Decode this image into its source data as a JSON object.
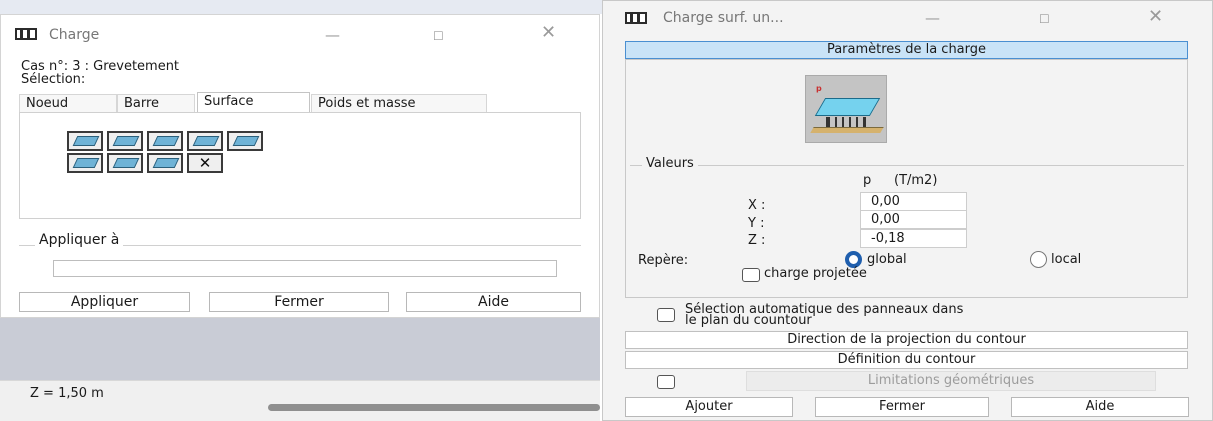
{
  "charge_window": {
    "title": "Charge",
    "case_line": "Cas n°: 3 : Grevetement",
    "selection_label": "Sélection:",
    "tabs": [
      {
        "label": "Noeud"
      },
      {
        "label": "Barre"
      },
      {
        "label": "Surface"
      },
      {
        "label": "Poids et masse"
      }
    ],
    "tools": [
      "surface-load-icon",
      "surface-load-icon",
      "surface-load-icon",
      "surface-load-icon",
      "surface-load-icon",
      "surface-load-icon",
      "surface-load-icon",
      "surface-load-icon",
      "delete-load-icon"
    ],
    "apply_group_label": "Appliquer à",
    "apply_input_value": "",
    "buttons": {
      "apply": "Appliquer",
      "close": "Fermer",
      "help": "Aide"
    }
  },
  "status": {
    "z_label": "Z = 1,50 m"
  },
  "surface_charge_window": {
    "title": "Charge surf. un...",
    "params_header": "Paramètres de la charge",
    "diagram_label": "p",
    "values_label": "Valeurs",
    "column_p": "p",
    "column_unit": "(T/m2)",
    "rows": [
      {
        "label": "X :",
        "value": "0,00"
      },
      {
        "label": "Y :",
        "value": "0,00"
      },
      {
        "label": "Z :",
        "value": "-0,18"
      }
    ],
    "repere_label": "Repère:",
    "repere_global": "global",
    "repere_local": "local",
    "repere_selected": "global",
    "projected_label": "charge projetée",
    "auto_select_line1": "Sélection automatique des panneaux dans",
    "auto_select_line2": "le plan du countour",
    "direction_button": "Direction de la projection du contour",
    "definition_button": "Définition du contour",
    "limitations_label": "Limitations géométriques",
    "buttons": {
      "add": "Ajouter",
      "close": "Fermer",
      "help": "Aide"
    }
  },
  "colors": {
    "accent": "#1f5fae",
    "header_fill": "#c9e3f7",
    "load_surface": "#75d2ee"
  }
}
